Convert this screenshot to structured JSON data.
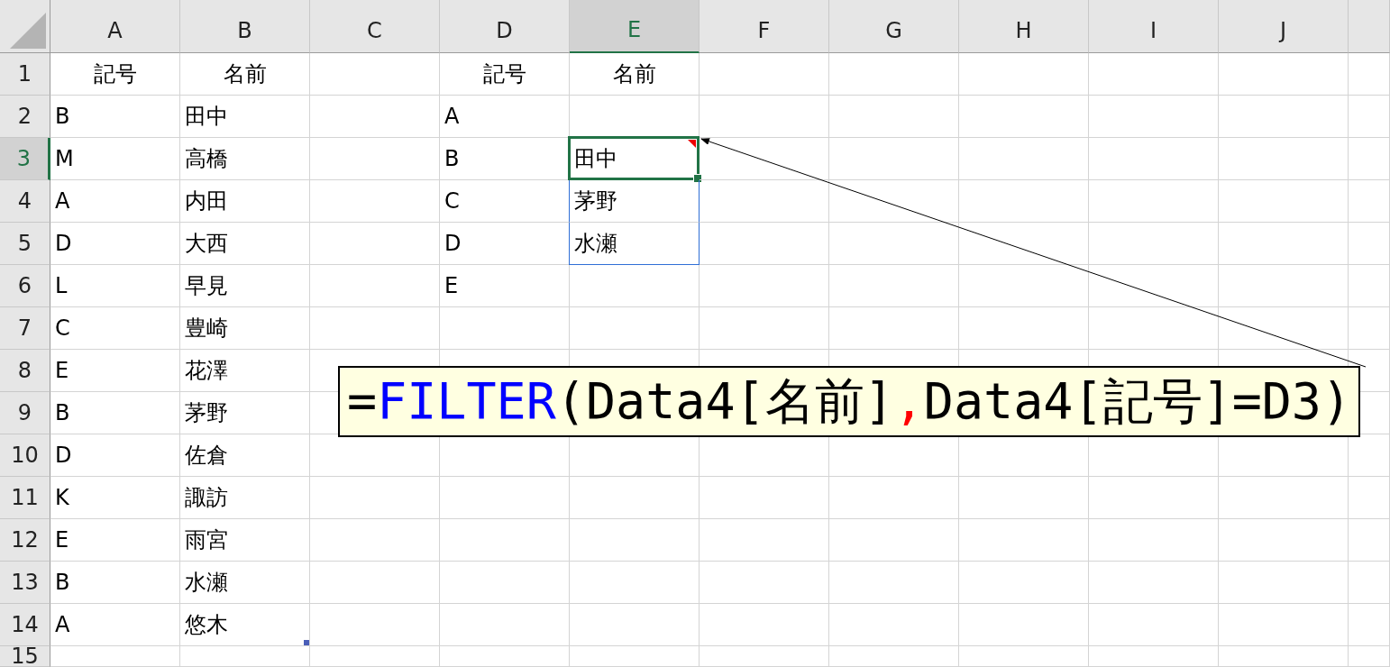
{
  "columns": [
    {
      "label": "A",
      "selected": false
    },
    {
      "label": "B",
      "selected": false
    },
    {
      "label": "C",
      "selected": false
    },
    {
      "label": "D",
      "selected": false
    },
    {
      "label": "E",
      "selected": true
    },
    {
      "label": "F",
      "selected": false
    },
    {
      "label": "G",
      "selected": false
    },
    {
      "label": "H",
      "selected": false
    },
    {
      "label": "I",
      "selected": false
    },
    {
      "label": "J",
      "selected": false
    }
  ],
  "rows": [
    {
      "label": "1",
      "selected": false
    },
    {
      "label": "2",
      "selected": false
    },
    {
      "label": "3",
      "selected": true
    },
    {
      "label": "4",
      "selected": false
    },
    {
      "label": "5",
      "selected": false
    },
    {
      "label": "6",
      "selected": false
    },
    {
      "label": "7",
      "selected": false
    },
    {
      "label": "8",
      "selected": false
    },
    {
      "label": "9",
      "selected": false
    },
    {
      "label": "10",
      "selected": false
    },
    {
      "label": "11",
      "selected": false
    },
    {
      "label": "12",
      "selected": false
    },
    {
      "label": "13",
      "selected": false
    },
    {
      "label": "14",
      "selected": false
    },
    {
      "label": "15",
      "selected": false
    }
  ],
  "data_table": {
    "header": [
      "記号",
      "名前"
    ],
    "rows": [
      [
        "B",
        "田中"
      ],
      [
        "M",
        "高橋"
      ],
      [
        "A",
        "内田"
      ],
      [
        "D",
        "大西"
      ],
      [
        "L",
        "早見"
      ],
      [
        "C",
        "豊崎"
      ],
      [
        "E",
        "花澤"
      ],
      [
        "B",
        "茅野"
      ],
      [
        "D",
        "佐倉"
      ],
      [
        "K",
        "諏訪"
      ],
      [
        "E",
        "雨宮"
      ],
      [
        "B",
        "水瀬"
      ],
      [
        "A",
        "悠木"
      ]
    ]
  },
  "lookup_table": {
    "header": [
      "記号",
      "名前"
    ],
    "rows": [
      {
        "symbol": "A"
      },
      {
        "symbol": "B",
        "name": {
          "text": "田中",
          "selected": true,
          "comment": true
        }
      },
      {
        "symbol": "C",
        "name": {
          "text": "茅野",
          "selected": false,
          "comment": false
        }
      },
      {
        "symbol": "D",
        "name": {
          "text": "水瀬",
          "selected": false,
          "comment": false
        }
      },
      {
        "symbol": "E"
      }
    ]
  },
  "formula_callout": [
    {
      "text": "=",
      "color": "#000000"
    },
    {
      "text": "FILTER",
      "color": "#0000ff"
    },
    {
      "text": "(Data4[名前]",
      "color": "#000000"
    },
    {
      "text": ",",
      "color": "#ff0000"
    },
    {
      "text": "Data4[記号]=D3)",
      "color": "#000000"
    }
  ]
}
